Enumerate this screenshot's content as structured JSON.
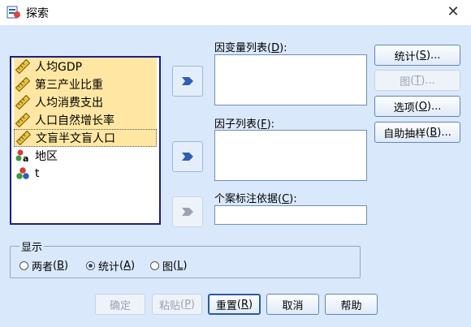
{
  "window": {
    "title": "探索",
    "close_glyph": "✕"
  },
  "variables": [
    {
      "label": "人均GDP",
      "icon": "ruler-icon",
      "selected": true
    },
    {
      "label": "第三产业比重",
      "icon": "ruler-icon",
      "selected": true
    },
    {
      "label": "人均消费支出",
      "icon": "ruler-icon",
      "selected": true
    },
    {
      "label": "人口自然增长率",
      "icon": "ruler-icon",
      "selected": true
    },
    {
      "label": "文盲半文盲人口",
      "icon": "ruler-icon",
      "selected": true
    },
    {
      "label": "地区",
      "icon": "nominal-icon",
      "selected": false
    },
    {
      "label": "t",
      "icon": "nominal-circles-icon",
      "selected": false
    }
  ],
  "fields": {
    "dependent": {
      "label": "因变量列表",
      "mnemonic": "D"
    },
    "factor": {
      "label": "因子列表",
      "mnemonic": "F"
    },
    "case_label": {
      "label": "个案标注依据",
      "mnemonic": "C"
    }
  },
  "side_buttons": [
    {
      "label": "统计",
      "mnemonic": "S",
      "suffix": "...",
      "enabled": true
    },
    {
      "label": "图",
      "mnemonic": "T",
      "suffix": "...",
      "enabled": false
    },
    {
      "label": "选项",
      "mnemonic": "O",
      "suffix": "...",
      "enabled": true
    },
    {
      "label": "自助抽样",
      "mnemonic": "B",
      "suffix": "...",
      "enabled": true
    }
  ],
  "display": {
    "label": "显示",
    "options": [
      {
        "label": "两者",
        "mnemonic": "B",
        "checked": false
      },
      {
        "label": "统计",
        "mnemonic": "A",
        "checked": true
      },
      {
        "label": "图",
        "mnemonic": "L",
        "checked": false
      }
    ]
  },
  "bottom_buttons": [
    {
      "label": "确定",
      "mnemonic": "",
      "enabled": false
    },
    {
      "label": "粘贴",
      "mnemonic": "P",
      "enabled": false
    },
    {
      "label": "重置",
      "mnemonic": "R",
      "enabled": true
    },
    {
      "label": "取消",
      "mnemonic": "",
      "enabled": true
    },
    {
      "label": "帮助",
      "mnemonic": "",
      "enabled": true
    }
  ],
  "colors": {
    "accent": "#2f5fb3",
    "selection": "#ffe7a3",
    "background": "#d9e8fb"
  }
}
